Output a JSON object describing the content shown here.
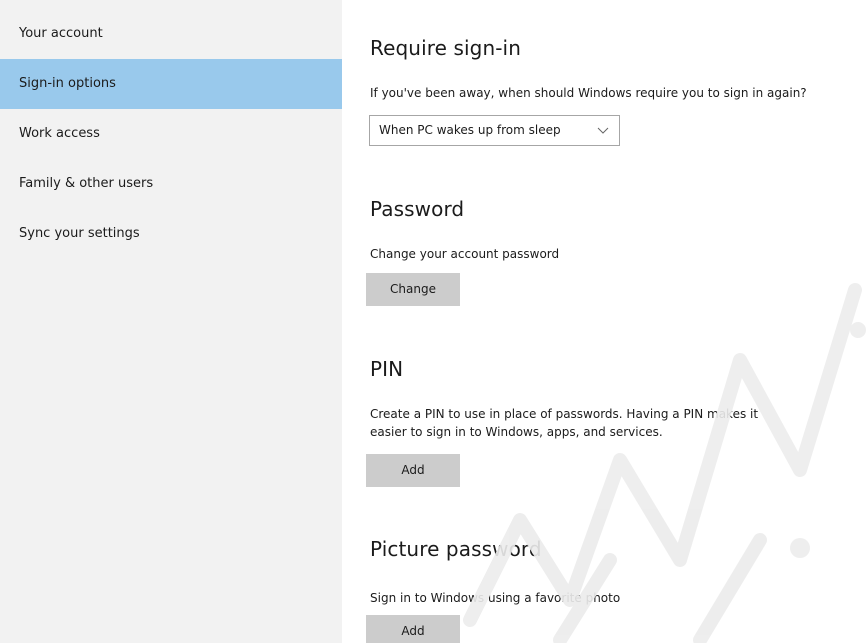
{
  "sidebar": {
    "items": [
      {
        "label": "Your account",
        "selected": false
      },
      {
        "label": "Sign-in options",
        "selected": true
      },
      {
        "label": "Work access",
        "selected": false
      },
      {
        "label": "Family & other users",
        "selected": false
      },
      {
        "label": "Sync your settings",
        "selected": false
      }
    ]
  },
  "require_signin": {
    "title": "Require sign-in",
    "description": "If you've been away, when should Windows require you to sign in again?",
    "dropdown_value": "When PC wakes up from sleep"
  },
  "password": {
    "title": "Password",
    "description": "Change your account password",
    "button_label": "Change"
  },
  "pin": {
    "title": "PIN",
    "description_line1": "Create a PIN to use in place of passwords. Having a PIN makes it",
    "description_line2": "easier to sign in to Windows, apps, and services.",
    "button_label": "Add"
  },
  "picture_password": {
    "title": "Picture password",
    "description": "Sign in to Windows using a favorite photo",
    "button_label": "Add"
  },
  "colors": {
    "sidebar_bg": "#f2f2f2",
    "selected_bg": "#99c9ec",
    "button_bg": "#cccccc",
    "watermark": "#ececec"
  },
  "icons": {
    "dropdown_chevron": "chevron-down-icon",
    "watermark_logo": "watermark-logo"
  }
}
